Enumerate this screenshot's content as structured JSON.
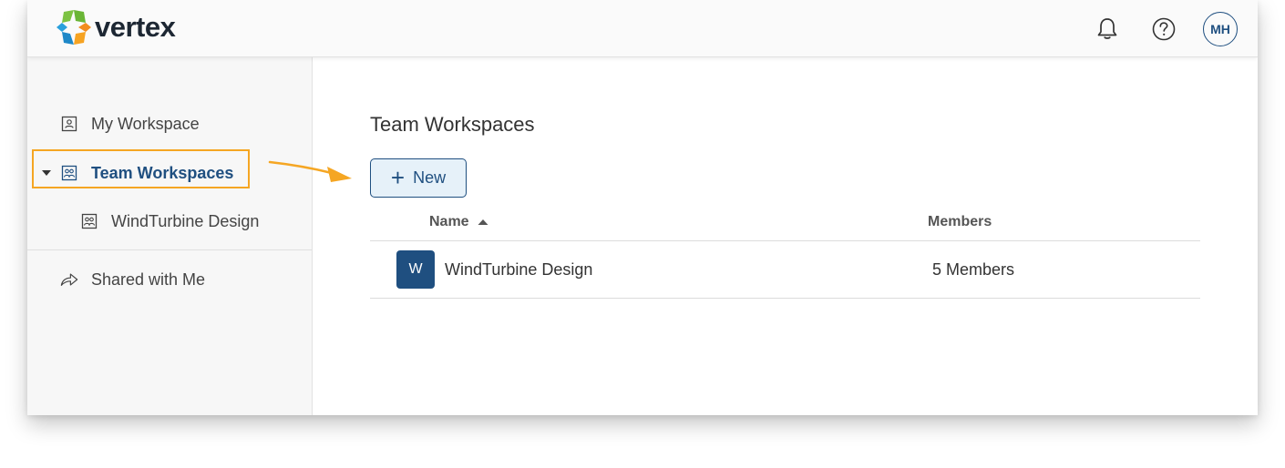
{
  "app": {
    "brand_name": "vertex",
    "user_initials": "MH"
  },
  "header": {
    "icons": [
      "notification-bell-icon",
      "help-icon"
    ]
  },
  "sidebar": {
    "items": [
      {
        "label": "My Workspace",
        "icon": "workspace-icon"
      },
      {
        "label": "Team Workspaces",
        "icon": "team-workspace-icon",
        "expanded": true,
        "active": true
      },
      {
        "label": "WindTurbine Design",
        "icon": "team-workspace-icon"
      },
      {
        "label": "Shared with Me",
        "icon": "share-icon"
      }
    ]
  },
  "main": {
    "title": "Team Workspaces",
    "new_button_label": "New",
    "table": {
      "columns": [
        "Name",
        "Members"
      ],
      "sort": {
        "column": "Name",
        "direction": "ascending"
      },
      "rows": [
        {
          "avatar_letter": "W",
          "name": "WindTurbine Design",
          "members": "5 Members"
        }
      ]
    }
  },
  "colors": {
    "accent": "#1f4f80",
    "highlight": "#f5a623",
    "new_button_bg": "#e6f1f9",
    "sidebar_bg": "#f7f7f7"
  }
}
